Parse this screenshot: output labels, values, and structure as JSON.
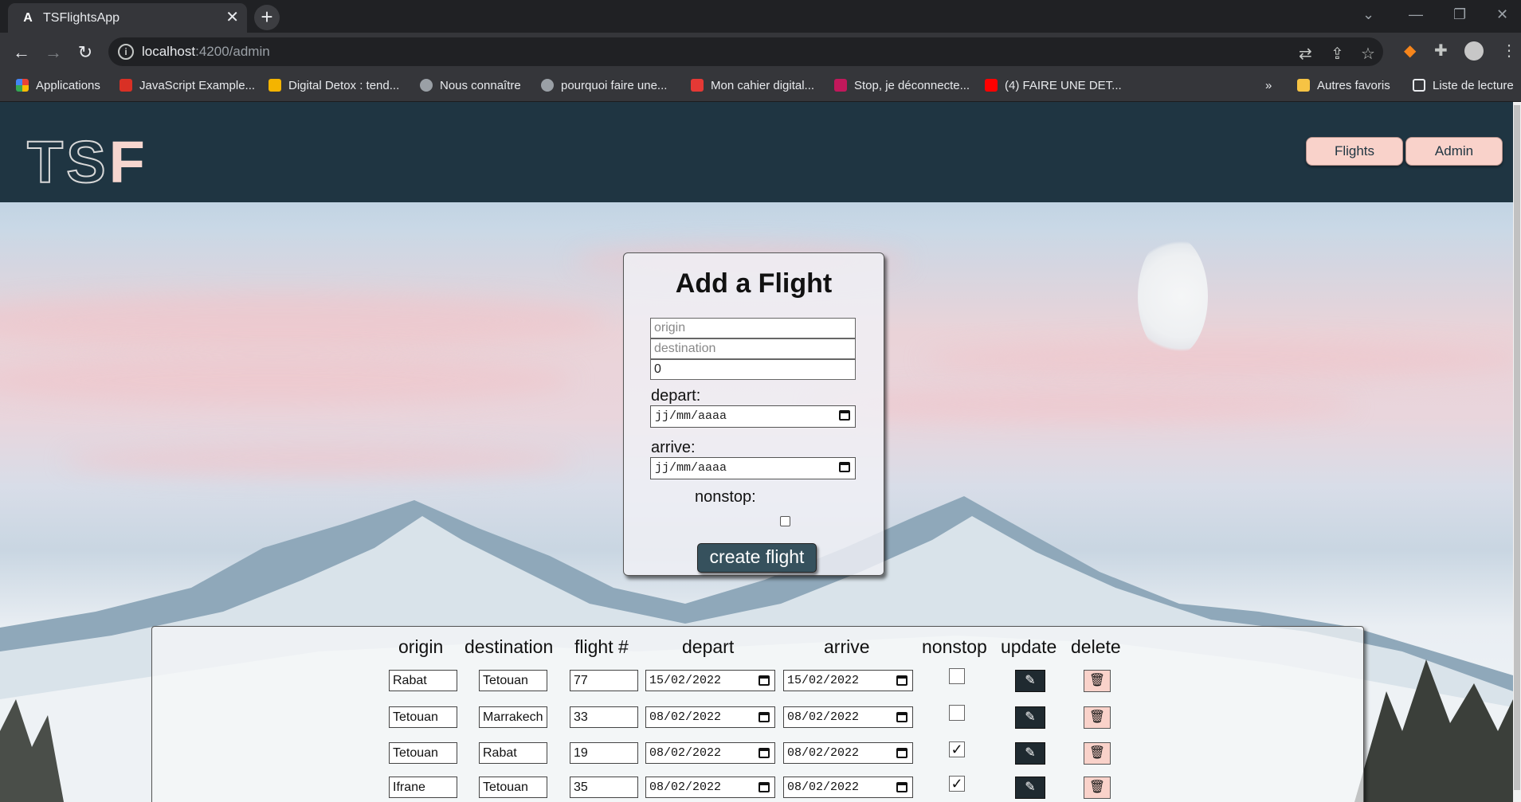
{
  "browser": {
    "tab_title": "TSFlightsApp",
    "tab_favicon": "A",
    "url_host": "localhost",
    "url_path": ":4200/admin",
    "bookmarks": [
      {
        "label": "Applications",
        "color": "#ea4335"
      },
      {
        "label": "JavaScript Example...",
        "color": "#d93025"
      },
      {
        "label": "Digital Detox : tend...",
        "color": "#f4b400"
      },
      {
        "label": "Nous connaître",
        "color": "#9aa0a6"
      },
      {
        "label": "pourquoi faire une...",
        "color": "#9aa0a6"
      },
      {
        "label": "Mon cahier digital...",
        "color": "#e53935"
      },
      {
        "label": "Stop, je déconnecte...",
        "color": "#c2185b"
      },
      {
        "label": "(4) FAIRE UNE DET...",
        "color": "#ff0000"
      }
    ],
    "bookmarks_overflow": "»",
    "other_favorites": "Autres favoris",
    "reading_list": "Liste de lecture"
  },
  "header": {
    "logo_ts": "TS",
    "logo_f": "F",
    "nav": [
      {
        "label": "Flights"
      },
      {
        "label": "Admin"
      }
    ]
  },
  "add_form": {
    "title": "Add a Flight",
    "origin_placeholder": "origin",
    "destination_placeholder": "destination",
    "number_value": "0",
    "depart_label": "depart:",
    "depart_value": "jj/mm/aaaa",
    "arrive_label": "arrive:",
    "arrive_value": "jj/mm/aaaa",
    "nonstop_label": "nonstop:",
    "submit_label": "create flight"
  },
  "table": {
    "headers": [
      "origin",
      "destination",
      "flight #",
      "depart",
      "arrive",
      "nonstop",
      "update",
      "delete"
    ],
    "rows": [
      {
        "origin": "Rabat",
        "destination": "Tetouan",
        "flight": "77",
        "depart": "15/02/2022",
        "arrive": "15/02/2022",
        "nonstop": false
      },
      {
        "origin": "Tetouan",
        "destination": "Marrakech",
        "flight": "33",
        "depart": "08/02/2022",
        "arrive": "08/02/2022",
        "nonstop": false
      },
      {
        "origin": "Tetouan",
        "destination": "Rabat",
        "flight": "19",
        "depart": "08/02/2022",
        "arrive": "08/02/2022",
        "nonstop": true
      },
      {
        "origin": "Ifrane",
        "destination": "Tetouan",
        "flight": "35",
        "depart": "08/02/2022",
        "arrive": "08/02/2022",
        "nonstop": true
      }
    ]
  },
  "colors": {
    "header_bg": "#1f3542",
    "accent_pink": "#f9d2ca",
    "button_dark": "#36515d"
  }
}
